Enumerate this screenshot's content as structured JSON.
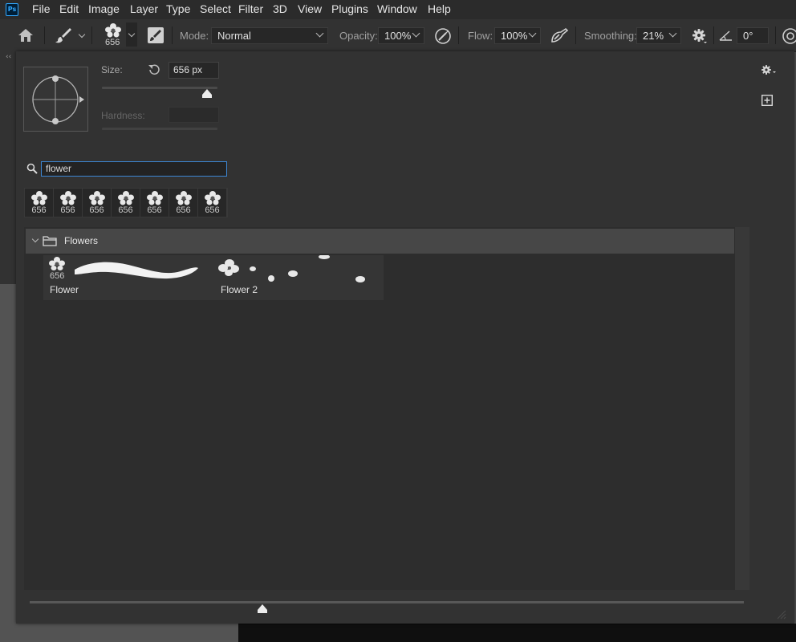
{
  "menubar": {
    "logo": "Ps",
    "items": [
      "File",
      "Edit",
      "Image",
      "Layer",
      "Type",
      "Select",
      "Filter",
      "3D",
      "View",
      "Plugins",
      "Window",
      "Help"
    ]
  },
  "options_bar": {
    "brush_size_badge": "656",
    "mode_label": "Mode:",
    "mode_value": "Normal",
    "opacity_label": "Opacity:",
    "opacity_value": "100%",
    "flow_label": "Flow:",
    "flow_value": "100%",
    "smoothing_label": "Smoothing:",
    "smoothing_value": "21%",
    "angle_value": "0°"
  },
  "brush_panel": {
    "size_label": "Size:",
    "size_value": "656 px",
    "size_slider_fraction": 0.91,
    "hardness_label": "Hardness:",
    "search_value": "flower",
    "recent_brushes": [
      "656",
      "656",
      "656",
      "656",
      "656",
      "656",
      "656"
    ],
    "group": {
      "name": "Flowers",
      "brushes": [
        {
          "name": "Flower",
          "size": "656"
        },
        {
          "name": "Flower 2",
          "size": ""
        }
      ]
    },
    "thumbnail_slider_fraction": 0.326
  },
  "icons": {
    "home": "home-icon",
    "brush": "brush-icon",
    "toggle_brush_panel": "brush-settings-panel-icon",
    "pressure_opacity": "pressure-opacity-icon",
    "airbrush": "airbrush-icon",
    "smoothing_gear": "gear-icon",
    "angle": "angle-icon",
    "pressure_size": "pressure-size-icon",
    "panel_gear": "gear-icon",
    "new_preset": "new-preset-icon",
    "search": "search-icon",
    "folder": "folder-icon"
  }
}
